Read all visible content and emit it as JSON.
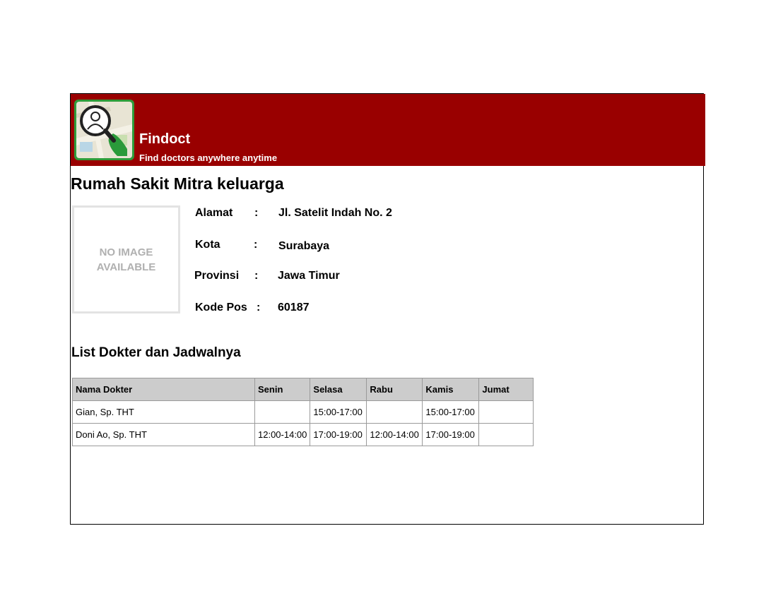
{
  "header": {
    "app_name": "Findoct",
    "tagline": "Find doctors anywhere anytime"
  },
  "hospital": {
    "name": "Rumah Sakit Mitra keluarga",
    "image_placeholder": "NO IMAGE AVAILABLE",
    "info": [
      {
        "label": "Alamat",
        "colon": ":",
        "value": "Jl. Satelit Indah No. 2"
      },
      {
        "label": "Kota",
        "colon": ":",
        "value": "Surabaya"
      },
      {
        "label": "Provinsi",
        "colon": ":",
        "value": "Jawa Timur"
      },
      {
        "label": "Kode Pos",
        "colon": ":",
        "value": "60187"
      }
    ]
  },
  "schedule": {
    "title": "List Dokter dan Jadwalnya",
    "columns": [
      "Nama Dokter",
      "Senin",
      "Selasa",
      "Rabu",
      "Kamis",
      "Jumat"
    ],
    "rows": [
      [
        "Gian, Sp. THT",
        "",
        "15:00-17:00",
        "",
        "15:00-17:00",
        ""
      ],
      [
        "Doni Ao, Sp. THT",
        "12:00-14:00",
        "17:00-19:00",
        "12:00-14:00",
        "17:00-19:00",
        ""
      ]
    ]
  },
  "colors": {
    "header_bg": "#990000",
    "table_header_bg": "#cccccc"
  },
  "icons": {
    "logo": "map-doctor-search-logo"
  }
}
